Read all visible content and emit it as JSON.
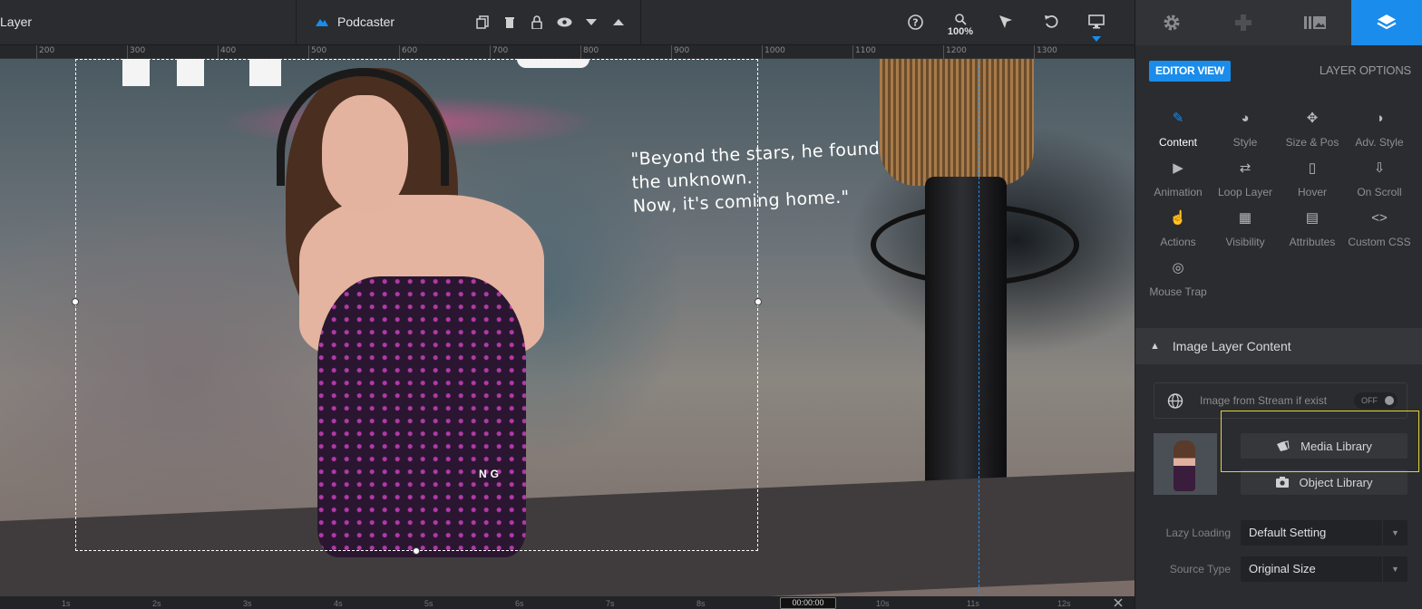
{
  "toolbar": {
    "layer_label": "Layer",
    "slider_name": "Podcaster",
    "zoom": "100%"
  },
  "ruler": {
    "ticks": [
      "200",
      "300",
      "400",
      "500",
      "600",
      "700",
      "800",
      "900",
      "1000",
      "1100",
      "1200",
      "1300"
    ]
  },
  "canvas": {
    "quote_lines": [
      "\"Beyond the stars, he found",
      "the unknown.",
      "Now, it's coming home.\""
    ],
    "subtext": "NG"
  },
  "timeline": {
    "labels": [
      "1s",
      "2s",
      "3s",
      "4s",
      "5s",
      "6s",
      "7s",
      "8s",
      "10s",
      "11s",
      "12s"
    ],
    "current_time": "00:00:00"
  },
  "panel": {
    "tabs": [
      {
        "name": "settings",
        "icon": "gear-icon"
      },
      {
        "name": "navigation",
        "icon": "gamepad-icon"
      },
      {
        "name": "slides",
        "icon": "slides-icon"
      },
      {
        "name": "layers",
        "icon": "layers-icon"
      }
    ],
    "editor_view": "EDITOR VIEW",
    "layer_options": "LAYER OPTIONS",
    "tools": [
      {
        "label": "Content",
        "icon": "pencil-icon",
        "glyph": "✎"
      },
      {
        "label": "Style",
        "icon": "palette-icon",
        "glyph": "◕"
      },
      {
        "label": "Size & Pos",
        "icon": "move-icon",
        "glyph": "✥"
      },
      {
        "label": "Adv. Style",
        "icon": "contrast-icon",
        "glyph": "◑"
      },
      {
        "label": "Animation",
        "icon": "play-icon",
        "glyph": "▶"
      },
      {
        "label": "Loop Layer",
        "icon": "loop-icon",
        "glyph": "⇄"
      },
      {
        "label": "Hover",
        "icon": "mouse-icon",
        "glyph": "▯"
      },
      {
        "label": "On Scroll",
        "icon": "scroll-icon",
        "glyph": "⇩"
      },
      {
        "label": "Actions",
        "icon": "hand-pointer-icon",
        "glyph": "☝"
      },
      {
        "label": "Visibility",
        "icon": "visibility-icon",
        "glyph": "▦"
      },
      {
        "label": "Attributes",
        "icon": "file-icon",
        "glyph": "▤"
      },
      {
        "label": "Custom CSS",
        "icon": "code-icon",
        "glyph": "<>"
      },
      {
        "label": "Mouse Trap",
        "icon": "crosshair-icon",
        "glyph": "◎"
      }
    ],
    "section_title": "Image Layer Content",
    "stream_label": "Image from Stream if exist",
    "stream_toggle": "OFF",
    "media_library": "Media Library",
    "object_library": "Object Library",
    "lazy_loading_label": "Lazy Loading",
    "lazy_loading_value": "Default Setting",
    "source_type_label": "Source Type",
    "source_type_value": "Original Size"
  }
}
